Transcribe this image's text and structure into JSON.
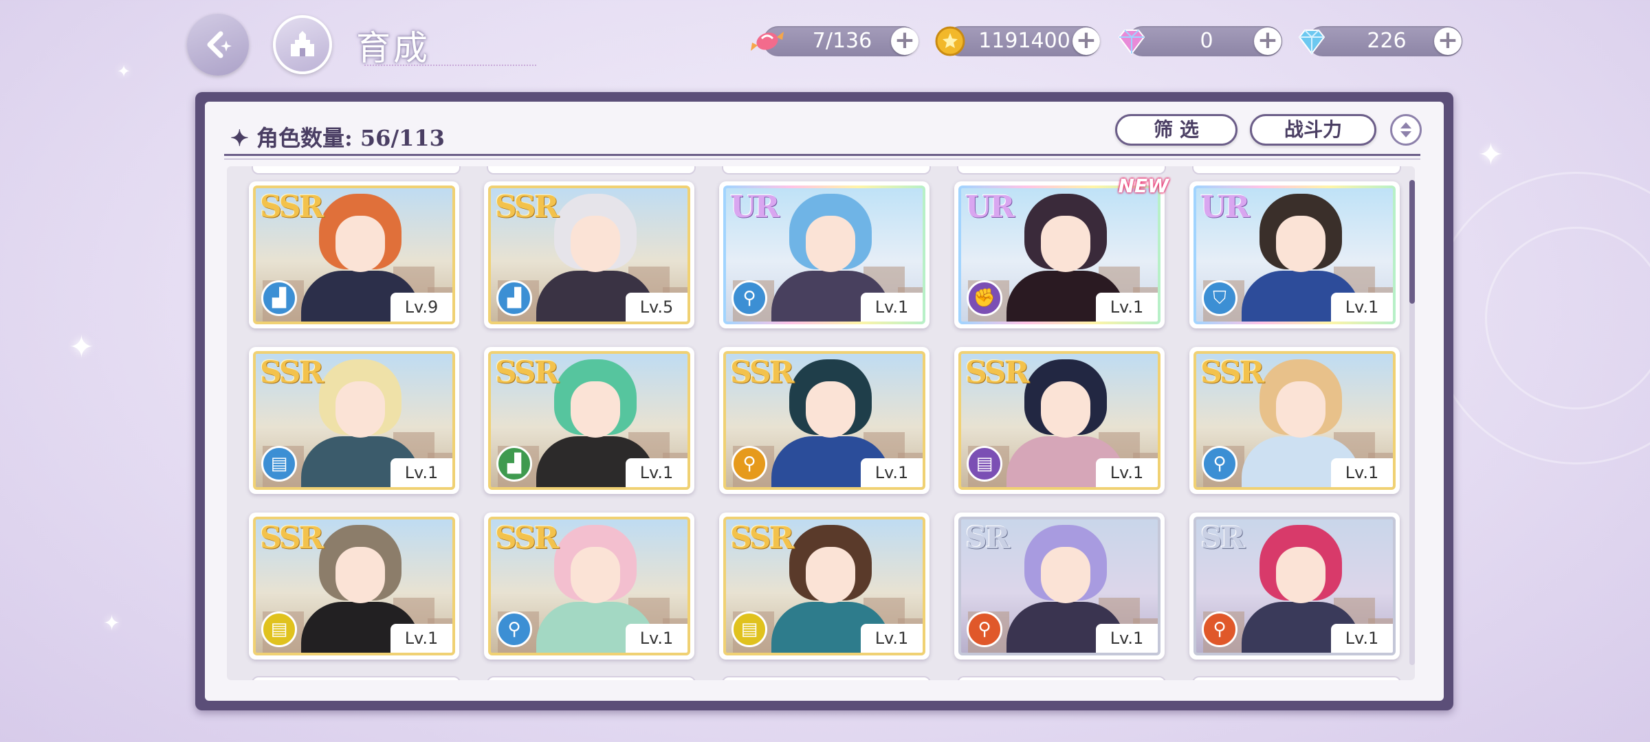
{
  "header": {
    "title": "育成",
    "back_icon": "back-arrow-icon",
    "home_icon": "castle-icon"
  },
  "resources": [
    {
      "name": "candy",
      "value": "7/136",
      "icon": "candy-icon"
    },
    {
      "name": "gold-coin",
      "value": "1191400",
      "icon": "coin-icon"
    },
    {
      "name": "rainbow-gem",
      "value": "0",
      "icon": "rainbow-gem-icon"
    },
    {
      "name": "diamond",
      "value": "226",
      "icon": "diamond-icon"
    }
  ],
  "panel": {
    "count_label": "角色数量: 56/113",
    "filter_label": "筛 选",
    "sort_label": "战斗力"
  },
  "cards": [
    {
      "rarity": "SSR",
      "level": "Lv.9",
      "role": "boot",
      "hair": "#e0703a",
      "outfit": "#2c2f4a",
      "new": false
    },
    {
      "rarity": "SSR",
      "level": "Lv.5",
      "role": "boot",
      "hair": "#e6e4ea",
      "outfit": "#3a3344",
      "new": false
    },
    {
      "rarity": "UR",
      "level": "Lv.1",
      "role": "lamp",
      "hair": "#6fb4e6",
      "outfit": "#48405e",
      "new": false
    },
    {
      "rarity": "UR",
      "level": "Lv.1",
      "role": "fist",
      "hair": "#3a2a3a",
      "outfit": "#2a1a22",
      "new": true
    },
    {
      "rarity": "UR",
      "level": "Lv.1",
      "role": "shield",
      "hair": "#3a2f2a",
      "outfit": "#2d4c9a",
      "new": false
    },
    {
      "rarity": "SSR",
      "level": "Lv.1",
      "role": "book",
      "hair": "#efe1a8",
      "outfit": "#3b5b6b",
      "new": false
    },
    {
      "rarity": "SSR",
      "level": "Lv.1",
      "role": "boot",
      "hair": "#56c59e",
      "outfit": "#2c2a2a",
      "new": false
    },
    {
      "rarity": "SSR",
      "level": "Lv.1",
      "role": "lamp",
      "hair": "#1f3e4a",
      "outfit": "#2b4d9a",
      "new": false
    },
    {
      "rarity": "SSR",
      "level": "Lv.1",
      "role": "book",
      "hair": "#222742",
      "outfit": "#d6a6b8",
      "new": false
    },
    {
      "rarity": "SSR",
      "level": "Lv.1",
      "role": "lamp",
      "hair": "#e8c18a",
      "outfit": "#cde0f2",
      "new": false
    },
    {
      "rarity": "SSR",
      "level": "Lv.1",
      "role": "book",
      "hair": "#8c7d6a",
      "outfit": "#222022",
      "new": false
    },
    {
      "rarity": "SSR",
      "level": "Lv.1",
      "role": "lamp",
      "hair": "#f3bfcf",
      "outfit": "#a3d8c3",
      "new": false
    },
    {
      "rarity": "SSR",
      "level": "Lv.1",
      "role": "book",
      "hair": "#5a3a2a",
      "outfit": "#2e7c8c",
      "new": false
    },
    {
      "rarity": "SR",
      "level": "Lv.1",
      "role": "lamp",
      "hair": "#a89be0",
      "outfit": "#3a3450",
      "new": false
    },
    {
      "rarity": "SR",
      "level": "Lv.1",
      "role": "lamp",
      "hair": "#d83a6a",
      "outfit": "#3a3a5a",
      "new": false
    }
  ],
  "new_label": "NEW",
  "role_colors": {
    "boot": "#3c8fd4",
    "lamp": "#3c8fd4",
    "fist": "#7b4fb4",
    "shield": "#3c8fd4",
    "book": "#3c8fd4"
  },
  "badge_colors": [
    "#3c8fd4",
    "#3c8fd4",
    "#3c8fd4",
    "#7b4fb4",
    "#3c8fd4",
    "#3c8fd4",
    "#3f9a4f",
    "#e69a1c",
    "#7b4fb4",
    "#3c8fd4",
    "#e0c21e",
    "#3c8fd4",
    "#e0c21e",
    "#e0582a",
    "#e0582a"
  ]
}
